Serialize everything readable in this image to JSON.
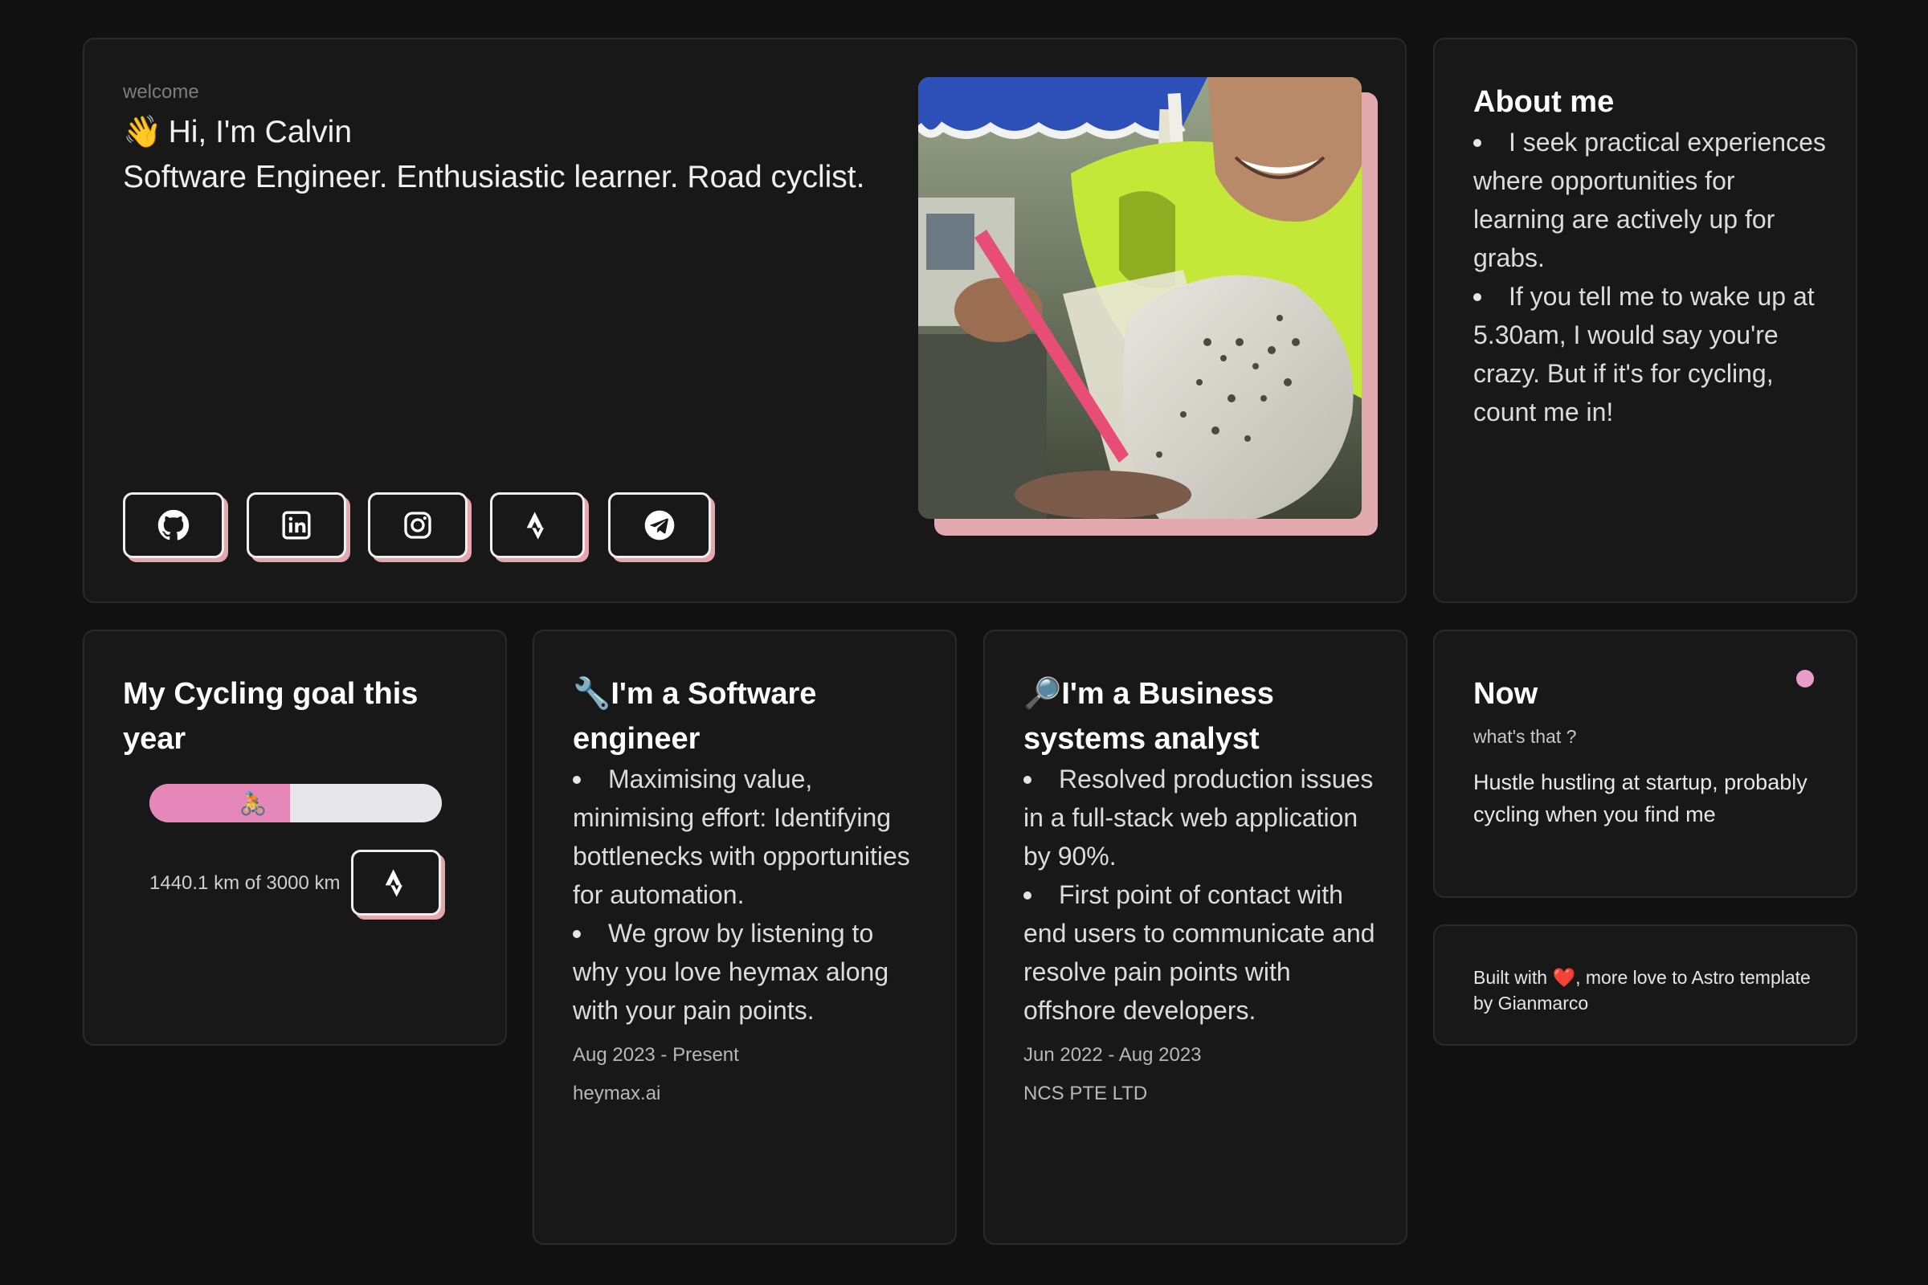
{
  "hero": {
    "welcome": "welcome",
    "wave_emoji": "👋",
    "greeting": "Hi, I'm Calvin",
    "tagline": "Software Engineer. Enthusiastic learner. Road cyclist.",
    "social_icons": [
      "github-icon",
      "linkedin-icon",
      "instagram-icon",
      "strava-icon",
      "telegram-icon"
    ]
  },
  "about": {
    "title": "About me",
    "items": [
      "I seek practical experiences where opportunities for learning are actively up for grabs.",
      "If you tell me to wake up at 5.30am, I would say you're crazy. But if it's for cycling, count me in!"
    ]
  },
  "goal": {
    "title": "My Cycling goal this year",
    "progress_percent": 48,
    "bike_emoji": "🚴",
    "distance_text": "1440.1 km of 3000 km",
    "progress_color": "#e587b8"
  },
  "swe": {
    "icon": "🔧",
    "title": "I'm a Software engineer",
    "items": [
      "Maximising value, minimising effort: Identifying bottlenecks with opportunities for automation.",
      "We grow by listening to why you love heymax along with your pain points."
    ],
    "dates": "Aug 2023 - Present",
    "company": "heymax.ai"
  },
  "bsa": {
    "icon": "🔎",
    "title": "I'm a Business systems analyst",
    "items": [
      "Resolved production issues in a full-stack web application by 90%.",
      "First point of contact with end users to communicate and resolve pain points with offshore developers."
    ],
    "dates": "Jun 2022 - Aug 2023",
    "company": "NCS PTE LTD"
  },
  "now": {
    "title": "Now",
    "subtitle": "what's that ?",
    "text": "Hustle hustling at startup, probably cycling when you find me",
    "status_dot_color": "#e99dca"
  },
  "footer": {
    "prefix": "Built with",
    "heart": "❤️",
    "suffix": ", more love to Astro template by Gianmarco"
  },
  "colors": {
    "background": "#111112",
    "card": "#181818",
    "accent_shadow": "#e5a6ad"
  }
}
